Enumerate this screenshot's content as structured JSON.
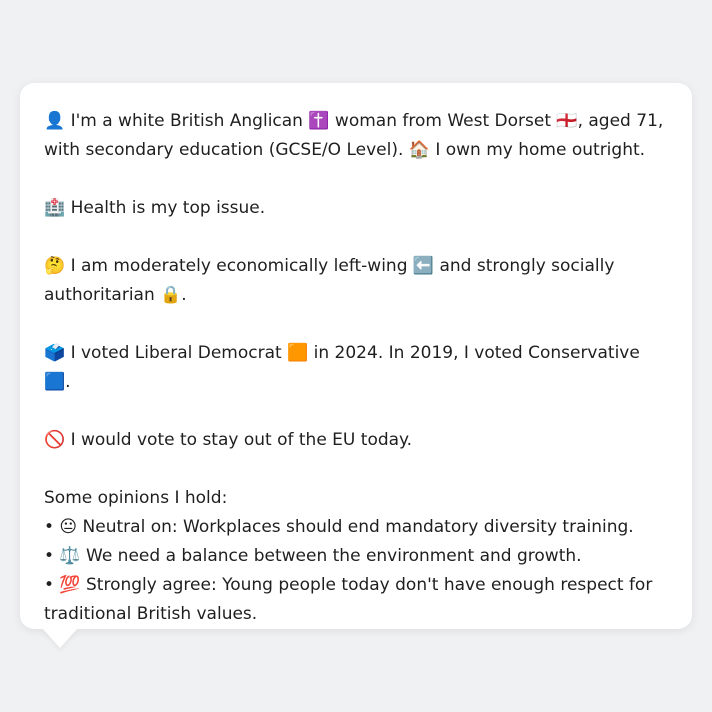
{
  "profile": {
    "intro_line1": "👤 I'm a white British Anglican ✝️ woman from West Dorset 🏴󠁧󠁢󠁥󠁮󠁧󠁿, aged 71,",
    "intro_line2": "with secondary education (GCSE/O Level). 🏠 I own my home outright.",
    "top_issue": "🏥 Health is my top issue.",
    "ideology_line1": "🤔 I am moderately economically left-wing ⬅️ and strongly socially",
    "ideology_line2": "authoritarian 🔒.",
    "votes": "🗳️ I voted Liberal Democrat 🟧 in 2024. In 2019, I voted Conservative 🟦.",
    "eu": "🚫 I would vote to stay out of the EU today.",
    "opinions_heading": "Some opinions I hold:",
    "opinion1": "• 😐 Neutral on: Workplaces should end mandatory diversity training.",
    "opinion2": "• ⚖️ We need a balance between the environment and growth.",
    "opinion3_line1": "• 💯 Strongly agree: Young people today don't have enough respect for",
    "opinion3_line2": "traditional British values."
  }
}
